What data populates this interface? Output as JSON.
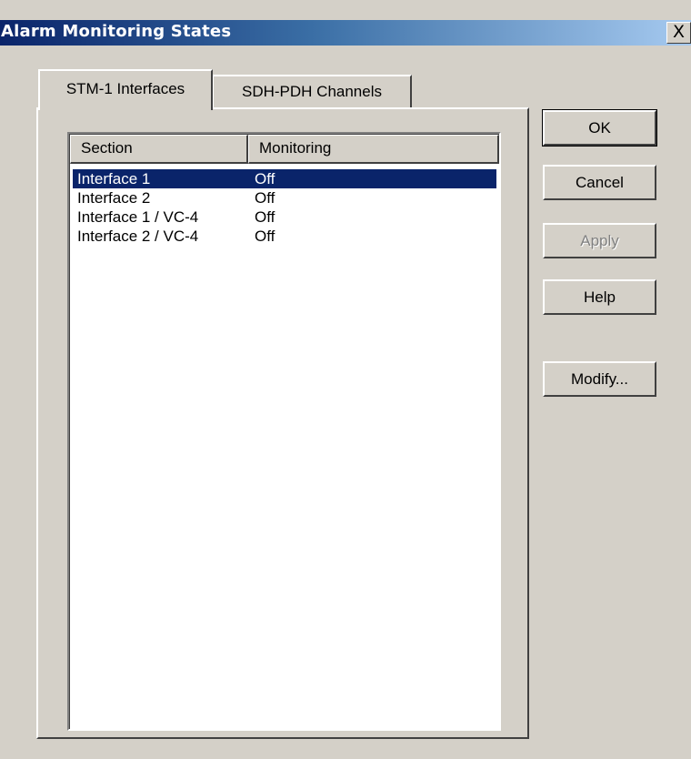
{
  "window": {
    "title": "Alarm Monitoring States",
    "close_glyph": "X"
  },
  "tabs": [
    {
      "label": "STM-1 Interfaces",
      "active": true
    },
    {
      "label": "SDH-PDH Channels",
      "active": false
    }
  ],
  "list": {
    "columns": [
      "Section",
      "Monitoring"
    ],
    "rows": [
      {
        "section": "Interface 1",
        "monitoring": "Off",
        "selected": true
      },
      {
        "section": "Interface 2",
        "monitoring": "Off",
        "selected": false
      },
      {
        "section": "Interface 1 / VC-4",
        "monitoring": "Off",
        "selected": false
      },
      {
        "section": "Interface 2 / VC-4",
        "monitoring": "Off",
        "selected": false
      }
    ]
  },
  "buttons": {
    "ok": "OK",
    "cancel": "Cancel",
    "apply": "Apply",
    "help": "Help",
    "modify": "Modify..."
  },
  "colors": {
    "face": "#d4d0c8",
    "title_start": "#0a246a",
    "title_end": "#a6caf0",
    "selection": "#0a246a"
  }
}
